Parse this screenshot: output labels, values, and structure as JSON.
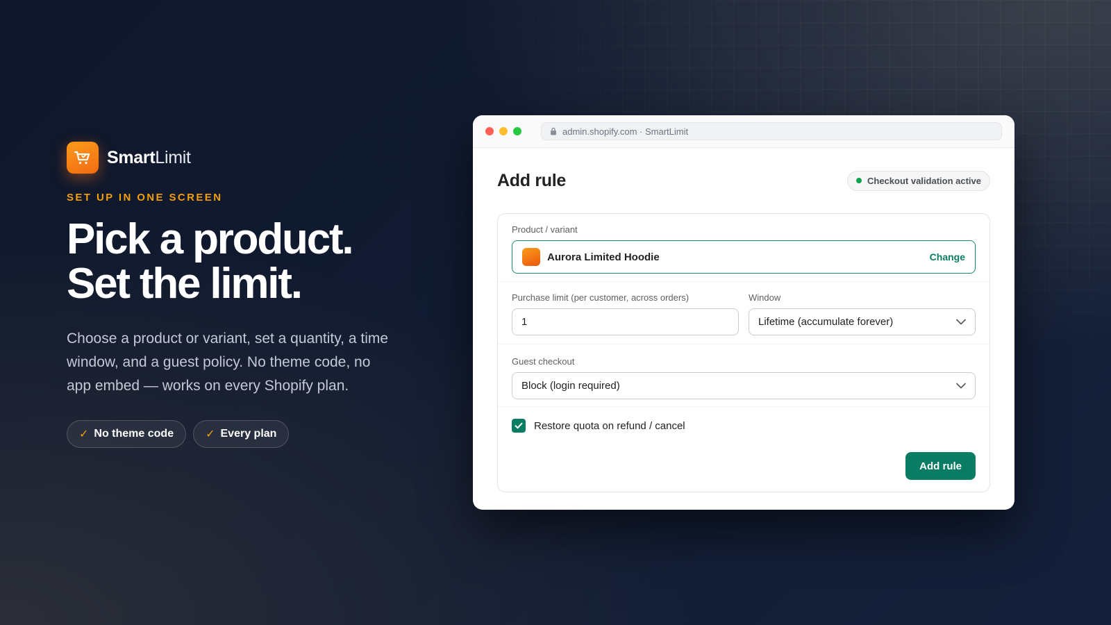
{
  "brand": {
    "name_bold": "Smart",
    "name_light": "Limit",
    "logo_icon": "cart-icon"
  },
  "hero": {
    "eyebrow": "SET UP IN ONE SCREEN",
    "headline_line1": "Pick a product.",
    "headline_line2": "Set the limit.",
    "description": "Choose a product or variant, set a quantity, a time window, and a guest policy. No theme code, no app embed — works on every Shopify plan.",
    "pills": [
      {
        "check": "✓",
        "label": "No theme code"
      },
      {
        "check": "✓",
        "label": "Every plan"
      }
    ]
  },
  "window": {
    "url": "admin.shopify.com · SmartLimit",
    "page_title": "Add rule",
    "status_badge": "Checkout validation active",
    "product": {
      "label": "Product / variant",
      "value": "Aurora Limited Hoodie",
      "change_label": "Change"
    },
    "purchase_limit": {
      "label": "Purchase limit (per customer, across orders)",
      "value": "1"
    },
    "window_select": {
      "label": "Window",
      "value": "Lifetime (accumulate forever)"
    },
    "guest_checkout": {
      "label": "Guest checkout",
      "value": "Block (login required)"
    },
    "restore_quota": {
      "label": "Restore quota on refund / cancel",
      "checked": true
    },
    "submit_label": "Add rule"
  },
  "colors": {
    "accent_orange": "#f59e0b",
    "primary_green": "#0a7c63",
    "status_green": "#12a150"
  }
}
